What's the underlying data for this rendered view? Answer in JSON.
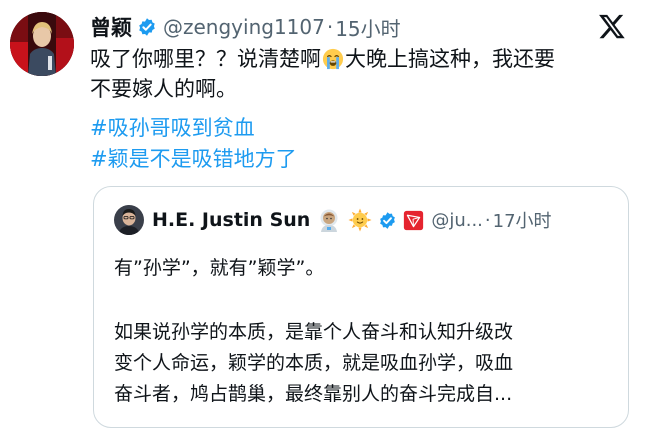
{
  "tweet": {
    "author_name": "曾颖",
    "handle": "@zengying1107",
    "separator": "·",
    "time": "15小时",
    "text_line_1a": "吸了你哪里？？说清楚啊",
    "text_line_1b": "大晚上搞这种，我还要",
    "text_line_2": "不要嫁人的啊。",
    "emoji": "loudly-crying-face-emoji",
    "hashtags": [
      "#吸孙哥吸到贫血",
      "#颖是不是吸错地方了"
    ]
  },
  "quote": {
    "author_name": "H.E. Justin Sun",
    "handle": "@ju...",
    "separator": "·",
    "time": "17小时",
    "emojis": [
      "astronaut-emoji",
      "sun-face-emoji"
    ],
    "badges": [
      "verified-badge",
      "tron-logo-badge"
    ],
    "line_1": "有”孙学”，就有”颖学”。",
    "line_2": "如果说孙学的本质，是靠个人奋斗和认知升级改",
    "line_3": "变个人命运，颖学的本质，就是吸血孙学，吸血",
    "line_4": "奋斗者，鸠占鹊巢，最终靠别人的奋斗完成自..."
  },
  "icons": {
    "x_logo": "x-logo-icon",
    "verified": "verified-badge-icon"
  },
  "colors": {
    "hashtag": "#1d9bf0",
    "verified": "#1d9bf0",
    "secondary_text": "#536471",
    "tron_red": "#e5242f",
    "card_border": "#cfd9de"
  }
}
